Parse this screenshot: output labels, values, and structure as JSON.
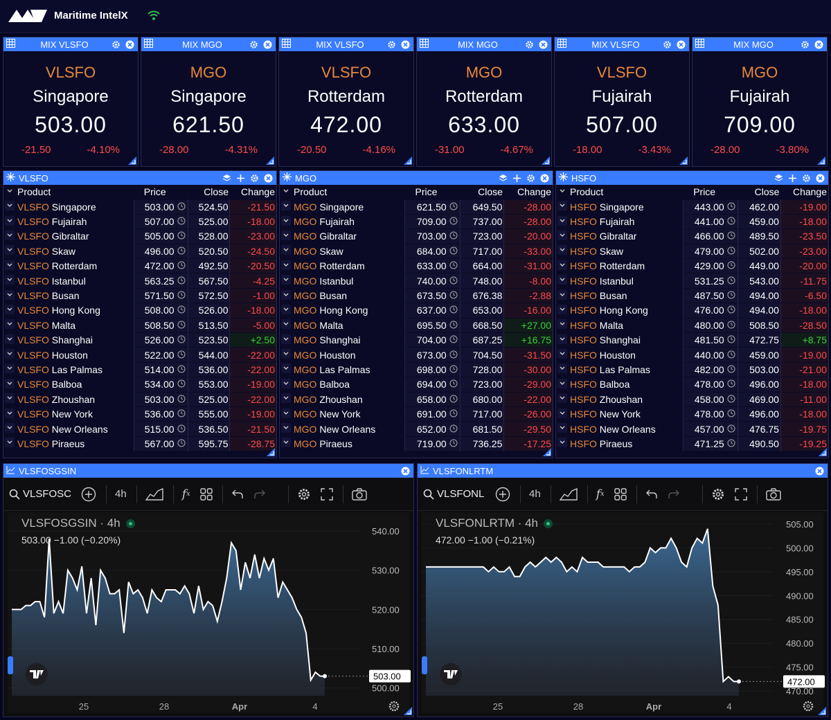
{
  "app": {
    "title": "Maritime IntelX"
  },
  "tiles": [
    {
      "header": "MIX VLSFO",
      "fuel": "VLSFO",
      "port": "Singapore",
      "price": "503.00",
      "change": "-21.50",
      "pct": "-4.10%"
    },
    {
      "header": "MIX MGO",
      "fuel": "MGO",
      "port": "Singapore",
      "price": "621.50",
      "change": "-28.00",
      "pct": "-4.31%"
    },
    {
      "header": "MIX VLSFO",
      "fuel": "VLSFO",
      "port": "Rotterdam",
      "price": "472.00",
      "change": "-20.50",
      "pct": "-4.16%"
    },
    {
      "header": "MIX MGO",
      "fuel": "MGO",
      "port": "Rotterdam",
      "price": "633.00",
      "change": "-31.00",
      "pct": "-4.67%"
    },
    {
      "header": "MIX VLSFO",
      "fuel": "VLSFO",
      "port": "Fujairah",
      "price": "507.00",
      "change": "-18.00",
      "pct": "-3.43%"
    },
    {
      "header": "MIX MGO",
      "fuel": "MGO",
      "port": "Fujairah",
      "price": "709.00",
      "change": "-28.00",
      "pct": "-3.80%"
    }
  ],
  "tables": [
    {
      "title": "VLSFO",
      "fuel": "VLSFO",
      "columns": [
        "Product",
        "Price",
        "Close",
        "Change"
      ],
      "rows": [
        [
          "Singapore",
          "503.00",
          "524.50",
          "-21.50"
        ],
        [
          "Fujairah",
          "507.00",
          "525.00",
          "-18.00"
        ],
        [
          "Gibraltar",
          "505.00",
          "528.00",
          "-23.00"
        ],
        [
          "Skaw",
          "496.00",
          "520.50",
          "-24.50"
        ],
        [
          "Rotterdam",
          "472.00",
          "492.50",
          "-20.50"
        ],
        [
          "Istanbul",
          "563.25",
          "567.50",
          "-4.25"
        ],
        [
          "Busan",
          "571.50",
          "572.50",
          "-1.00"
        ],
        [
          "Hong Kong",
          "508.00",
          "526.00",
          "-18.00"
        ],
        [
          "Malta",
          "508.50",
          "513.50",
          "-5.00"
        ],
        [
          "Shanghai",
          "526.00",
          "523.50",
          "+2.50"
        ],
        [
          "Houston",
          "522.00",
          "544.00",
          "-22.00"
        ],
        [
          "Las Palmas",
          "514.00",
          "536.00",
          "-22.00"
        ],
        [
          "Balboa",
          "534.00",
          "553.00",
          "-19.00"
        ],
        [
          "Zhoushan",
          "503.00",
          "525.00",
          "-22.00"
        ],
        [
          "New York",
          "536.00",
          "555.00",
          "-19.00"
        ],
        [
          "New Orleans",
          "515.00",
          "536.50",
          "-21.50"
        ],
        [
          "Piraeus",
          "567.00",
          "595.75",
          "-28.75"
        ]
      ]
    },
    {
      "title": "MGO",
      "fuel": "MGO",
      "columns": [
        "Product",
        "Price",
        "Close",
        "Change"
      ],
      "rows": [
        [
          "Singapore",
          "621.50",
          "649.50",
          "-28.00"
        ],
        [
          "Fujairah",
          "709.00",
          "737.00",
          "-28.00"
        ],
        [
          "Gibraltar",
          "703.00",
          "723.00",
          "-20.00"
        ],
        [
          "Skaw",
          "684.00",
          "717.00",
          "-33.00"
        ],
        [
          "Rotterdam",
          "633.00",
          "664.00",
          "-31.00"
        ],
        [
          "Istanbul",
          "740.00",
          "748.00",
          "-8.00"
        ],
        [
          "Busan",
          "673.50",
          "676.38",
          "-2.88"
        ],
        [
          "Hong Kong",
          "637.00",
          "653.00",
          "-16.00"
        ],
        [
          "Malta",
          "695.50",
          "668.50",
          "+27.00"
        ],
        [
          "Shanghai",
          "704.00",
          "687.25",
          "+16.75"
        ],
        [
          "Houston",
          "673.00",
          "704.50",
          "-31.50"
        ],
        [
          "Las Palmas",
          "698.00",
          "728.00",
          "-30.00"
        ],
        [
          "Balboa",
          "694.00",
          "723.00",
          "-29.00"
        ],
        [
          "Zhoushan",
          "658.00",
          "680.00",
          "-22.00"
        ],
        [
          "New York",
          "691.00",
          "717.00",
          "-26.00"
        ],
        [
          "New Orleans",
          "652.00",
          "681.50",
          "-29.50"
        ],
        [
          "Piraeus",
          "719.00",
          "736.25",
          "-17.25"
        ]
      ]
    },
    {
      "title": "HSFO",
      "fuel": "HSFO",
      "columns": [
        "Product",
        "Price",
        "Close",
        "Change"
      ],
      "rows": [
        [
          "Singapore",
          "443.00",
          "462.00",
          "-19.00"
        ],
        [
          "Fujairah",
          "441.00",
          "459.00",
          "-18.00"
        ],
        [
          "Gibraltar",
          "466.00",
          "489.50",
          "-23.50"
        ],
        [
          "Skaw",
          "479.00",
          "502.00",
          "-23.00"
        ],
        [
          "Rotterdam",
          "429.00",
          "449.00",
          "-20.00"
        ],
        [
          "Istanbul",
          "531.25",
          "543.00",
          "-11.75"
        ],
        [
          "Busan",
          "487.50",
          "494.00",
          "-6.50"
        ],
        [
          "Hong Kong",
          "476.00",
          "494.00",
          "-18.00"
        ],
        [
          "Malta",
          "480.00",
          "508.50",
          "-28.50"
        ],
        [
          "Shanghai",
          "481.50",
          "472.75",
          "+8.75"
        ],
        [
          "Houston",
          "440.00",
          "459.00",
          "-19.00"
        ],
        [
          "Las Palmas",
          "482.00",
          "503.00",
          "-21.00"
        ],
        [
          "Balboa",
          "478.00",
          "496.00",
          "-18.00"
        ],
        [
          "Zhoushan",
          "458.00",
          "469.00",
          "-11.00"
        ],
        [
          "New York",
          "478.00",
          "496.00",
          "-18.00"
        ],
        [
          "New Orleans",
          "457.00",
          "476.75",
          "-19.75"
        ],
        [
          "Piraeus",
          "471.25",
          "490.50",
          "-19.25"
        ]
      ]
    }
  ],
  "charts": [
    {
      "header": "VLSFOSGSIN",
      "search": "VLSFOSC",
      "interval": "4h",
      "label": "VLSFOSGSIN · 4h",
      "values": "503.00  −1.00 (−0.20%)",
      "last": "503.00"
    },
    {
      "header": "VLSFONLRTM",
      "search": "VLSFONL",
      "interval": "4h",
      "label": "VLSFONLRTM · 4h",
      "values": "472.00  −1.00 (−0.21%)",
      "last": "472.00"
    }
  ],
  "chart_data": [
    {
      "type": "area",
      "xticks": [
        "25",
        "28",
        "Apr",
        "4"
      ],
      "ylim": [
        498,
        543
      ],
      "yticks": [
        "540.00",
        "530.00",
        "520.00",
        "510.00",
        "500.00"
      ],
      "x": [
        0,
        1,
        2,
        3,
        4,
        5,
        6,
        7,
        8,
        9,
        10,
        11,
        12,
        13,
        14,
        15,
        16,
        17,
        18,
        19,
        20,
        21,
        22,
        23,
        24,
        25,
        26,
        27,
        28,
        29,
        30,
        31,
        32,
        33,
        34,
        35,
        36,
        37,
        38,
        39,
        40,
        41,
        42,
        43,
        44,
        45,
        46,
        47,
        48,
        49,
        50,
        51,
        52,
        53,
        54,
        55,
        56,
        57,
        58,
        59,
        60,
        61,
        62,
        63,
        64,
        65,
        66,
        67,
        68,
        69,
        70,
        71,
        72,
        73,
        74,
        75,
        76,
        77,
        78
      ],
      "values": [
        520,
        520,
        520,
        521,
        521,
        522,
        522,
        518,
        538,
        519,
        522,
        519,
        530,
        528,
        525,
        531,
        519,
        528,
        516,
        530,
        528,
        524,
        524,
        525,
        514,
        527,
        524,
        525,
        523,
        519,
        525,
        523,
        522,
        525,
        525,
        525,
        524,
        526,
        524,
        519,
        526,
        520,
        522,
        521,
        517,
        522,
        528,
        537,
        535,
        525,
        532,
        528,
        534,
        528,
        533,
        530,
        533,
        523,
        527,
        525,
        523,
        520,
        518,
        514,
        502,
        504,
        503,
        503
      ],
      "last": 503.0
    },
    {
      "type": "area",
      "xticks": [
        "25",
        "28",
        "Apr",
        "4"
      ],
      "ylim": [
        469,
        506
      ],
      "yticks": [
        "505.00",
        "500.00",
        "495.00",
        "490.00",
        "485.00",
        "480.00",
        "475.00",
        "470.00"
      ],
      "values": [
        496,
        496,
        496,
        496,
        496,
        496,
        496,
        496,
        496,
        496,
        496,
        496,
        495,
        496,
        495,
        495,
        496,
        494,
        494,
        496,
        497,
        496,
        497,
        498,
        497,
        498,
        497,
        495,
        496,
        495,
        498,
        497,
        497,
        497,
        496,
        496,
        496,
        496,
        496,
        495,
        496,
        496,
        497,
        500,
        499,
        500,
        500,
        502,
        500,
        497,
        496,
        500,
        502,
        501,
        504,
        492,
        488,
        472,
        473,
        472,
        472
      ],
      "last": 472.0
    }
  ],
  "colors": {
    "accent": "#3a7cff",
    "fuel": "#e8883a",
    "neg": "#ff4a4a",
    "pos": "#3ad13a"
  }
}
